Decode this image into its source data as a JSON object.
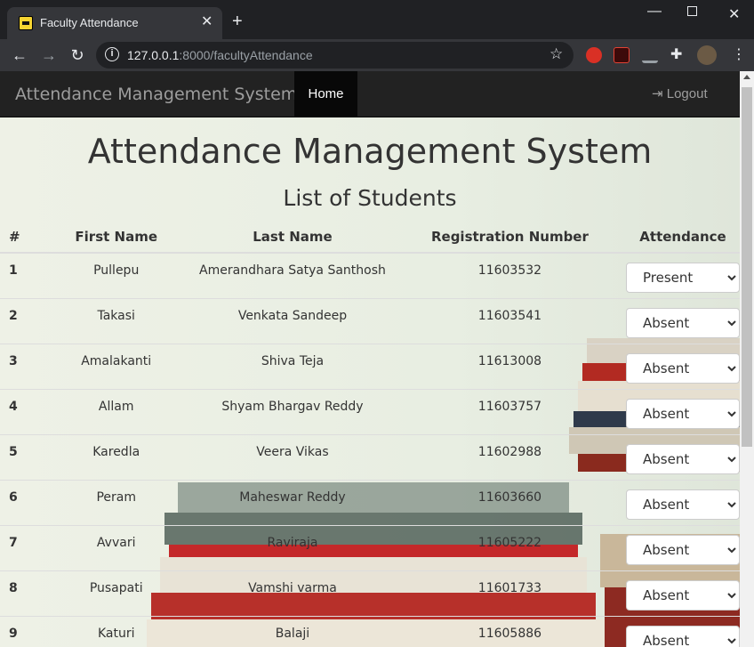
{
  "browser": {
    "tab_title": "Faculty Attendance",
    "url_host": "127.0.0.1",
    "url_rest": ":8000/facultyAttendance"
  },
  "navbar": {
    "brand": "Attendance Management System",
    "home": "Home",
    "logout": "Logout"
  },
  "heading": "Attendance Management System",
  "subheading": "List of Students",
  "table": {
    "headers": [
      "#",
      "First Name",
      "Last Name",
      "Registration Number",
      "Attendance"
    ],
    "rows": [
      [
        "1",
        "Pullepu",
        "Amerandhara Satya Santhosh",
        "11603532",
        "Present"
      ],
      [
        "2",
        "Takasi",
        "Venkata Sandeep",
        "11603541",
        "Absent"
      ],
      [
        "3",
        "Amalakanti",
        "Shiva Teja",
        "11613008",
        "Absent"
      ],
      [
        "4",
        "Allam",
        "Shyam Bhargav Reddy",
        "11603757",
        "Absent"
      ],
      [
        "5",
        "Karedla",
        "Veera Vikas",
        "11602988",
        "Absent"
      ],
      [
        "6",
        "Peram",
        "Maheswar Reddy",
        "11603660",
        "Absent"
      ],
      [
        "7",
        "Avvari",
        "Raviraja",
        "11605222",
        "Absent"
      ],
      [
        "8",
        "Pusapati",
        "Vamshi varma",
        "11601733",
        "Absent"
      ],
      [
        "9",
        "Katuri",
        "Balaji",
        "11605886",
        "Absent"
      ]
    ]
  }
}
